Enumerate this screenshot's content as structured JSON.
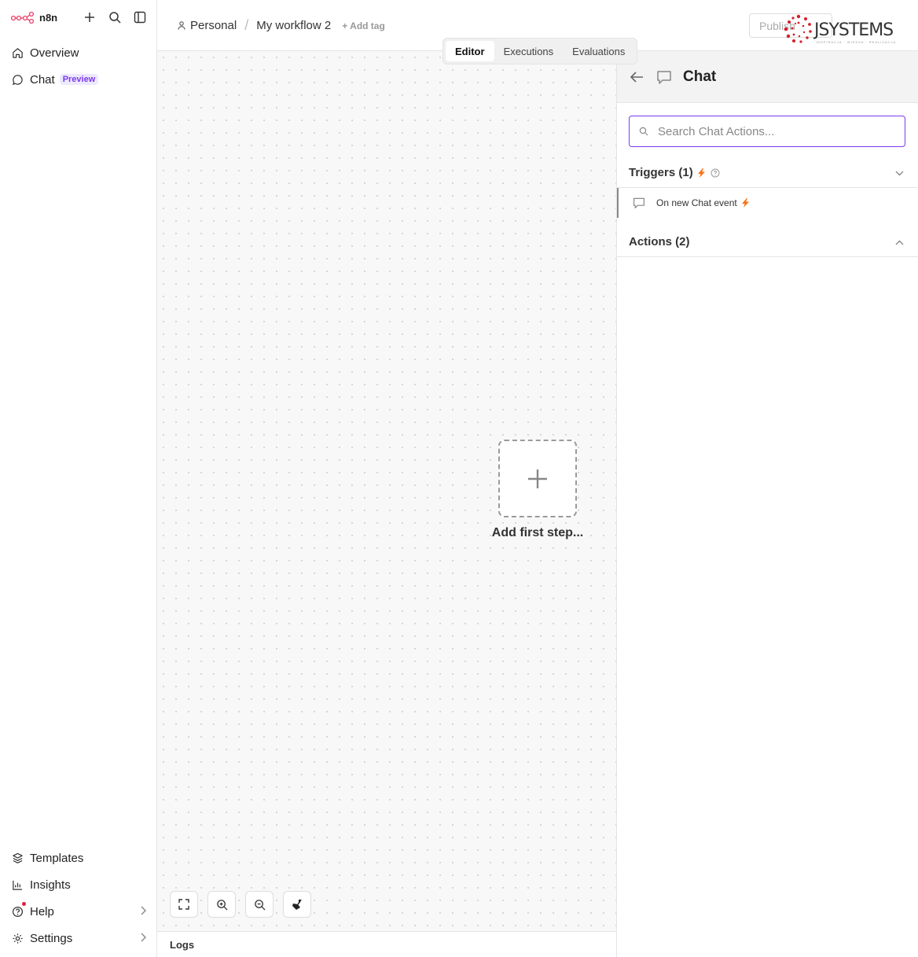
{
  "app": {
    "name": "n8n"
  },
  "sidebar": {
    "items": [
      {
        "label": "Overview"
      },
      {
        "label": "Chat",
        "badge": "Preview"
      }
    ],
    "bottom": [
      {
        "label": "Templates"
      },
      {
        "label": "Insights"
      },
      {
        "label": "Help"
      },
      {
        "label": "Settings"
      }
    ]
  },
  "header": {
    "project": "Personal",
    "workflow": "My workflow 2",
    "add_tag": "+ Add tag",
    "publish": "Publish",
    "watermark": "JSYSTEMS",
    "watermark_sub": "INSPIRACJA · WIEDZA · REALIZACJA"
  },
  "tabs": [
    {
      "label": "Editor",
      "active": true
    },
    {
      "label": "Executions",
      "active": false
    },
    {
      "label": "Evaluations",
      "active": false
    }
  ],
  "canvas": {
    "add_first_step": "Add first step..."
  },
  "logs": {
    "label": "Logs"
  },
  "panel": {
    "title": "Chat",
    "search_placeholder": "Search Chat Actions...",
    "triggers_label": "Triggers (1)",
    "trigger_item": "On new Chat event",
    "actions_label": "Actions (2)"
  },
  "colors": {
    "accent": "#7c3aed",
    "bolt": "#f97316",
    "n8n": "#ea4b71"
  }
}
